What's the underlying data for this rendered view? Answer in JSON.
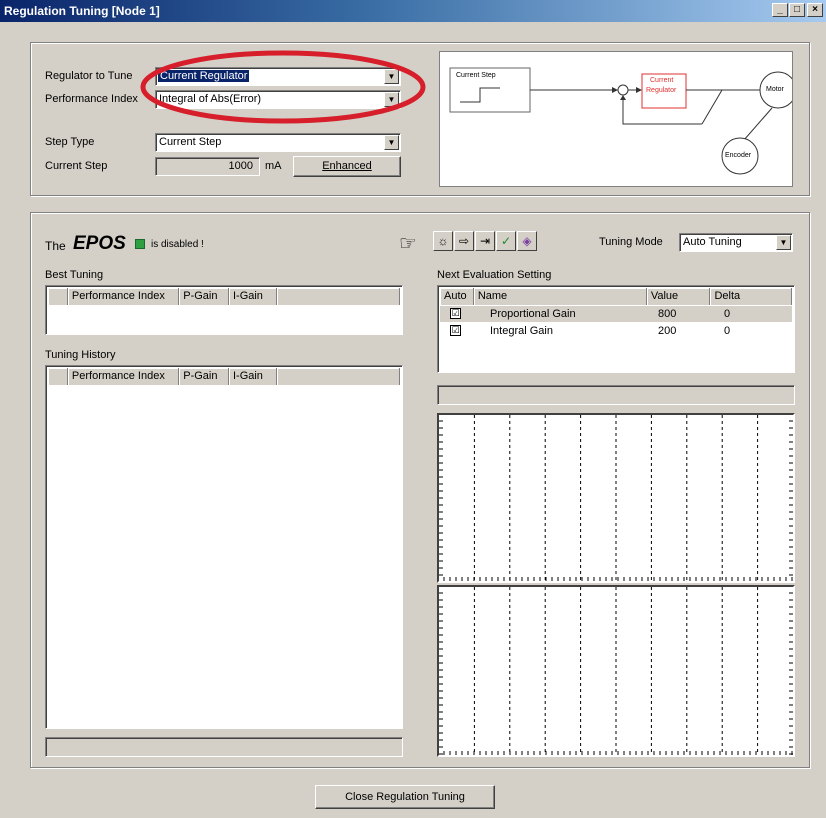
{
  "window": {
    "title": "Regulation Tuning  [Node 1]",
    "min_label": "_",
    "max_label": "□",
    "close_label": "×"
  },
  "config": {
    "regulator_label": "Regulator to Tune",
    "regulator_value": "Current Regulator",
    "performance_label": "Performance Index",
    "performance_value": "Integral of Abs(Error)",
    "step_type_label": "Step Type",
    "step_type_value": "Current Step",
    "current_step_label": "Current Step",
    "current_step_value": "1000",
    "current_step_unit": "mA",
    "enhanced_label": "Enhanced"
  },
  "diagram": {
    "step_box": "Current Step",
    "regulator_box_line1": "Current",
    "regulator_box_line2": "Regulator",
    "motor": "Motor",
    "encoder": "Encoder",
    "accent": "#e03030"
  },
  "status": {
    "prefix": "The",
    "brand": "EPOS",
    "suffix": "is disabled !",
    "led_color": "#2ea043"
  },
  "toolbar": {
    "hand_icon": "pointing-hand-icon",
    "icons": [
      "lightbulb-icon",
      "forward-arrow-icon",
      "step-icon",
      "checkmark-icon",
      "stamp-icon"
    ],
    "glyphs": [
      "☼",
      "⇨",
      "⇥",
      "✓",
      "◈"
    ],
    "tuning_mode_label": "Tuning Mode",
    "tuning_mode_value": "Auto Tuning"
  },
  "best_tuning": {
    "title": "Best Tuning",
    "columns": [
      "",
      "Performance Index",
      "P-Gain",
      "I-Gain",
      ""
    ]
  },
  "history": {
    "title": "Tuning History",
    "columns": [
      "",
      "Performance Index",
      "P-Gain",
      "I-Gain",
      ""
    ]
  },
  "next_eval": {
    "title": "Next Evaluation Setting",
    "columns": [
      "Auto",
      "Name",
      "Value",
      "Delta"
    ],
    "rows": [
      {
        "checked": "☑",
        "name": "Proportional Gain",
        "value": "800",
        "delta": "0"
      },
      {
        "checked": "☑",
        "name": "Integral Gain",
        "value": "200",
        "delta": "0"
      }
    ]
  },
  "footer": {
    "close_label": "Close Regulation Tuning"
  }
}
